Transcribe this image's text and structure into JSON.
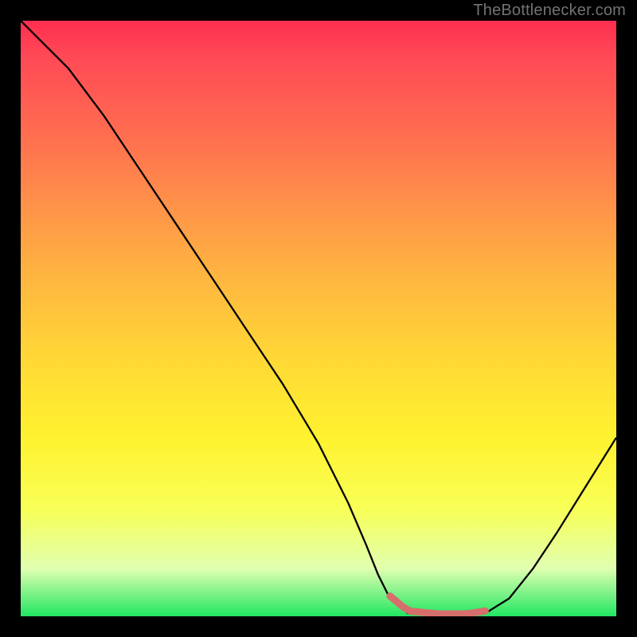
{
  "credit_text": "TheBottlenecker.com",
  "chart_data": {
    "type": "line",
    "title": "",
    "xlabel": "",
    "ylabel": "",
    "xlim": [
      0,
      100
    ],
    "ylim": [
      0,
      100
    ],
    "x": [
      0,
      3,
      8,
      14,
      20,
      26,
      32,
      38,
      44,
      50,
      55,
      58,
      60,
      62,
      65,
      70,
      75,
      78,
      82,
      86,
      90,
      95,
      100
    ],
    "values": [
      100,
      97,
      92,
      84,
      75,
      66,
      57,
      48,
      39,
      29,
      19,
      12,
      7,
      3,
      0.5,
      0,
      0,
      0.5,
      3,
      8,
      14,
      22,
      30
    ],
    "nadir_x_range": [
      62,
      78
    ]
  }
}
